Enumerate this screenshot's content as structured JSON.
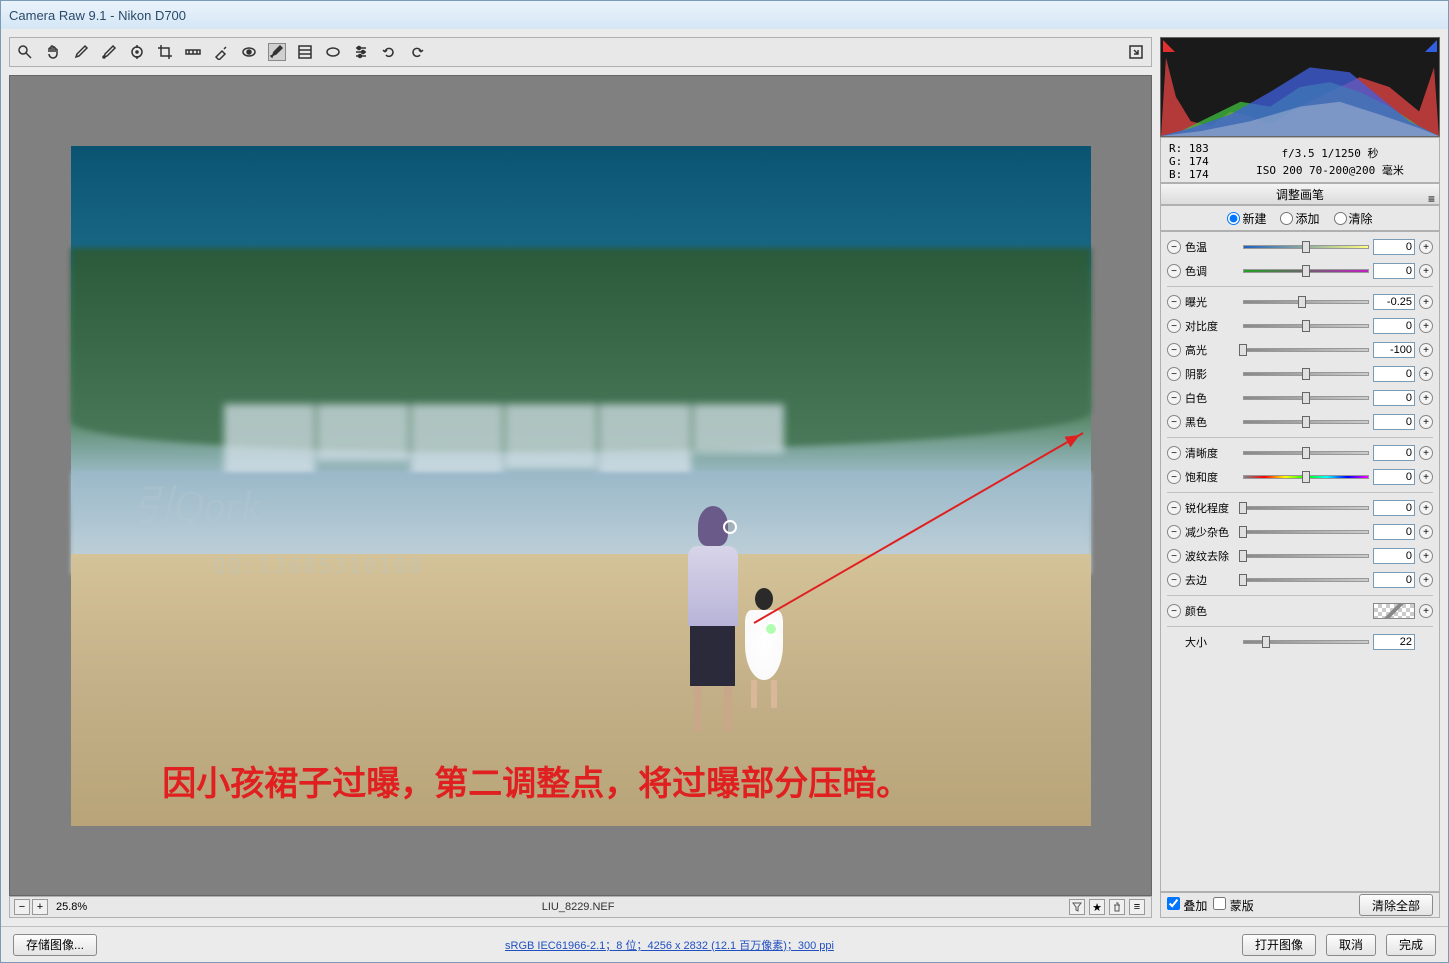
{
  "window": {
    "title": "Camera Raw 9.1  -  Nikon D700"
  },
  "toolbar_icons": [
    "zoom",
    "hand",
    "eyedropper",
    "sampler",
    "target",
    "crop",
    "crop2",
    "straighten",
    "spot",
    "redeye",
    "brush",
    "gradient",
    "radial",
    "prefs",
    "rotate-ccw",
    "rotate-cw"
  ],
  "canvas": {
    "zoom": "25.8%",
    "filename": "LIU_8229.NEF",
    "annotation": "因小孩裙子过曝，第二调整点，将过曝部分压暗。",
    "watermark1": "引Qork",
    "watermark2": "QQ:13605310108"
  },
  "readout": {
    "r": "R:  183",
    "g": "G:  174",
    "b": "B:  174",
    "exif1": "f/3.5  1/1250 秒",
    "exif2": "ISO 200  70-200@200 毫米"
  },
  "panel_title": "调整画笔",
  "modes": {
    "new": "新建",
    "add": "添加",
    "clear": "清除",
    "selected": "new"
  },
  "sliders": [
    {
      "group": 1,
      "id": "temp",
      "label": "色温",
      "value": "0",
      "pos": 50,
      "track": "temp"
    },
    {
      "group": 1,
      "id": "tint",
      "label": "色调",
      "value": "0",
      "pos": 50,
      "track": "tint"
    },
    {
      "group": 2,
      "id": "exposure",
      "label": "曝光",
      "value": "-0.25",
      "pos": 47
    },
    {
      "group": 2,
      "id": "contrast",
      "label": "对比度",
      "value": "0",
      "pos": 50
    },
    {
      "group": 2,
      "id": "highlights",
      "label": "高光",
      "value": "-100",
      "pos": 0
    },
    {
      "group": 2,
      "id": "shadows",
      "label": "阴影",
      "value": "0",
      "pos": 50
    },
    {
      "group": 2,
      "id": "whites",
      "label": "白色",
      "value": "0",
      "pos": 50
    },
    {
      "group": 2,
      "id": "blacks",
      "label": "黑色",
      "value": "0",
      "pos": 50
    },
    {
      "group": 3,
      "id": "clarity",
      "label": "清晰度",
      "value": "0",
      "pos": 50
    },
    {
      "group": 3,
      "id": "saturation",
      "label": "饱和度",
      "value": "0",
      "pos": 50,
      "track": "sat"
    },
    {
      "group": 4,
      "id": "sharpen",
      "label": "锐化程度",
      "value": "0",
      "pos": 0
    },
    {
      "group": 4,
      "id": "noise",
      "label": "减少杂色",
      "value": "0",
      "pos": 0
    },
    {
      "group": 4,
      "id": "moire",
      "label": "波纹去除",
      "value": "0",
      "pos": 0
    },
    {
      "group": 4,
      "id": "defringe",
      "label": "去边",
      "value": "0",
      "pos": 0
    }
  ],
  "color_row": {
    "label": "颜色"
  },
  "size_row": {
    "label": "大小",
    "value": "22",
    "pos": 18
  },
  "bottom": {
    "overlay": "叠加",
    "mask": "蒙版",
    "clear_all": "清除全部"
  },
  "footer": {
    "save": "存储图像...",
    "link": "sRGB IEC61966-2.1；8 位；4256 x 2832 (12.1 百万像素)；300 ppi",
    "open": "打开图像",
    "cancel": "取消",
    "done": "完成"
  }
}
